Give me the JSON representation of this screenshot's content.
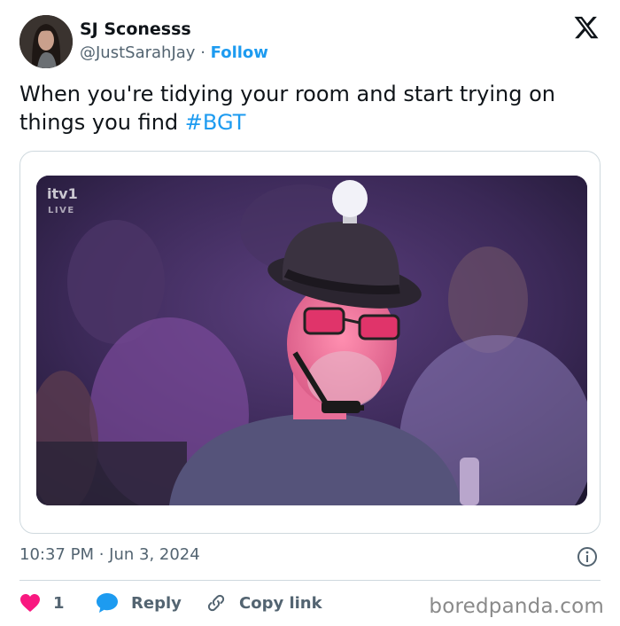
{
  "header": {
    "display_name": "SJ Sconesss",
    "handle": "@JustSarahJay",
    "separator": "·",
    "follow_label": "Follow"
  },
  "tweet": {
    "text": "When you're tidying your room and start trying on things you find",
    "hashtag": "#BGT"
  },
  "media": {
    "broadcast_logo": "itv1",
    "broadcast_status": "LIVE"
  },
  "meta": {
    "timestamp": "10:37 PM · Jun 3, 2024"
  },
  "actions": {
    "like_count": "1",
    "reply_label": "Reply",
    "copy_label": "Copy link"
  },
  "watermark": "boredpanda.com",
  "colors": {
    "accent": "#1d9bf0",
    "like": "#f91880",
    "muted": "#536471"
  }
}
